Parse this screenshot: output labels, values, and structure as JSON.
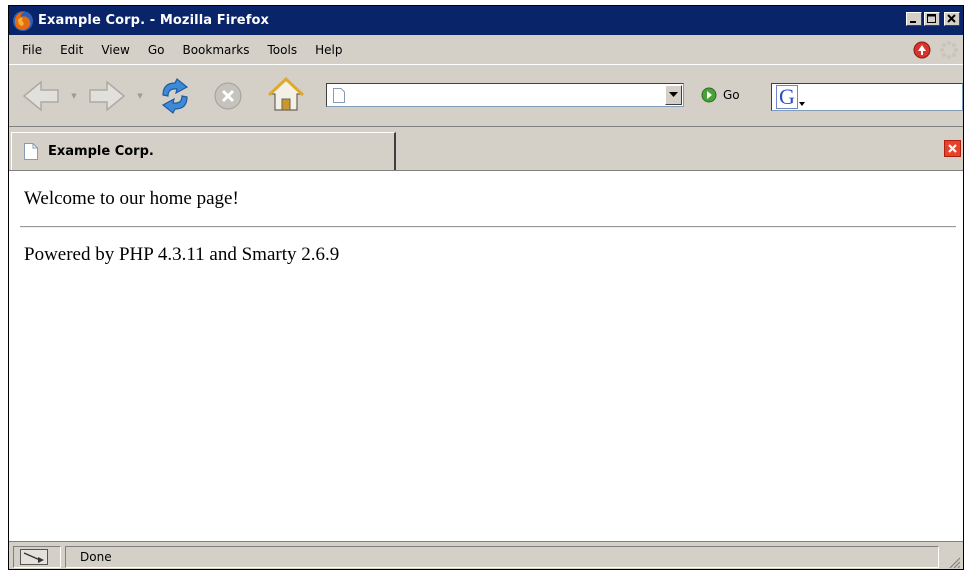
{
  "window": {
    "title": "Example Corp. - Mozilla Firefox"
  },
  "menubar": {
    "items": [
      {
        "label": "File",
        "name": "menu-file"
      },
      {
        "label": "Edit",
        "name": "menu-edit"
      },
      {
        "label": "View",
        "name": "menu-view"
      },
      {
        "label": "Go",
        "name": "menu-go"
      },
      {
        "label": "Bookmarks",
        "name": "menu-bookmarks"
      },
      {
        "label": "Tools",
        "name": "menu-tools"
      },
      {
        "label": "Help",
        "name": "menu-help"
      }
    ]
  },
  "toolbar": {
    "back_icon": "back-arrow-icon",
    "forward_icon": "forward-arrow-icon",
    "reload_icon": "reload-icon",
    "stop_icon": "stop-icon",
    "home_icon": "home-icon",
    "url_value": "",
    "go_label": "Go",
    "search_engine": "G",
    "search_value": ""
  },
  "tabs": [
    {
      "label": "Example Corp.",
      "active": true
    }
  ],
  "content": {
    "welcome_text": "Welcome to our home page!",
    "powered_text": "Powered by PHP 4.3.11 and Smarty 2.6.9"
  },
  "statusbar": {
    "text": "Done"
  },
  "colors": {
    "titlebar": "#0a246a",
    "chrome": "#d4d0c8",
    "tab_close": "#e8412c"
  }
}
